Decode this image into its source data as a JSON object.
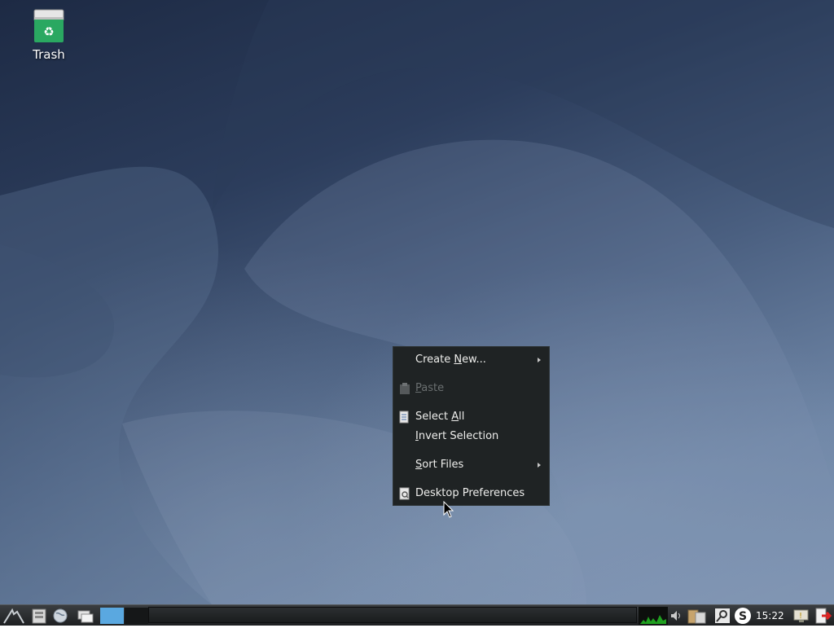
{
  "desktop": {
    "icons": [
      {
        "label": "Trash",
        "icon": "trash-icon"
      }
    ]
  },
  "context_menu": {
    "items": [
      {
        "label_pre": "Create ",
        "label_mnemonic": "N",
        "label_post": "ew...",
        "has_submenu": true,
        "enabled": true,
        "icon": null
      },
      {
        "label_pre": "",
        "label_mnemonic": "P",
        "label_post": "aste",
        "has_submenu": false,
        "enabled": false,
        "icon": "paste-icon"
      },
      {
        "label_pre": "Select ",
        "label_mnemonic": "A",
        "label_post": "ll",
        "has_submenu": false,
        "enabled": true,
        "icon": "select-all-icon"
      },
      {
        "label_pre": "",
        "label_mnemonic": "I",
        "label_post": "nvert Selection",
        "has_submenu": false,
        "enabled": true,
        "icon": null
      },
      {
        "label_pre": "",
        "label_mnemonic": "S",
        "label_post": "ort Files",
        "has_submenu": true,
        "enabled": true,
        "icon": null
      },
      {
        "label_pre": "Desktop Preferences",
        "label_mnemonic": "",
        "label_post": "",
        "has_submenu": false,
        "enabled": true,
        "icon": "desktop-preferences-icon"
      }
    ]
  },
  "taskbar": {
    "launchers": [
      "menu-icon",
      "file-manager-icon",
      "web-browser-icon",
      "show-desktop-icon"
    ],
    "workspaces": [
      "workspace-1",
      "workspace-2"
    ],
    "tray": [
      "cpu-monitor-icon",
      "volume-icon",
      "clipboard-icon",
      "search-icon",
      "skype-icon",
      "network-icon",
      "logout-icon"
    ],
    "clock": "15:22"
  },
  "colors": {
    "menu_bg": "#1f2324",
    "menu_text": "#eeeeec",
    "menu_disabled": "#6a6f70",
    "trash_green": "#2aa861"
  }
}
